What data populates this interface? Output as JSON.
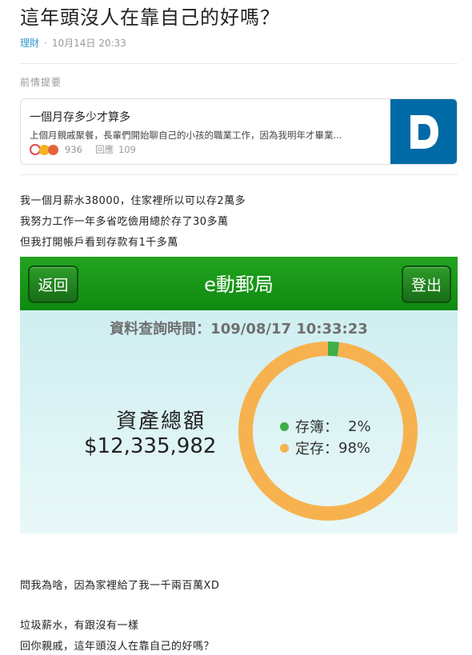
{
  "post": {
    "title": "這年頭沒人在靠自己的好嗎？",
    "category": "理財",
    "separator": "·",
    "datetime": "10月14日 20:33"
  },
  "previous": {
    "label": "前情提要",
    "card": {
      "title": "一個月存多少才算多",
      "snippet": "上個月親戚聚餐，長輩們開始聊自己的小孩的職業工作，因為我明年才畢業...",
      "reaction_count": "936",
      "reply_label": "回應",
      "reply_count": "109"
    }
  },
  "body": {
    "lines_top": [
      "我一個月薪水38000，住家裡所以可以存2萬多",
      "我努力工作一年多省吃儉用總於存了30多萬",
      "但我打開帳戶看到存款有1千多萬"
    ],
    "lines_bottom": [
      "問我為啥，因為家裡給了我一千兩百萬XD",
      "垃圾薪水，有跟沒有一樣",
      "回你親戚，這年頭沒人在靠自己的好嗎？"
    ]
  },
  "screenshot": {
    "back_label": "返回",
    "app_title": "e動郵局",
    "logout_label": "登出",
    "query_time": "資料查詢時間：109/08/17 10:33:23",
    "assets_label": "資產總額",
    "assets_value": "$12,335,982",
    "legend": [
      {
        "label": "存簿：",
        "value": "2%",
        "color": "#3fae49"
      },
      {
        "label": "定存：",
        "value": "98%",
        "color": "#f7b24f"
      }
    ]
  },
  "chart_data": {
    "type": "pie",
    "categories": [
      "存簿",
      "定存"
    ],
    "values": [
      2,
      98
    ],
    "colors": [
      "#3fae49",
      "#f7b24f"
    ]
  },
  "colors": {
    "accent": "#3397cf",
    "thumb_bg": "#006aa6",
    "bar_green": "#169417"
  }
}
